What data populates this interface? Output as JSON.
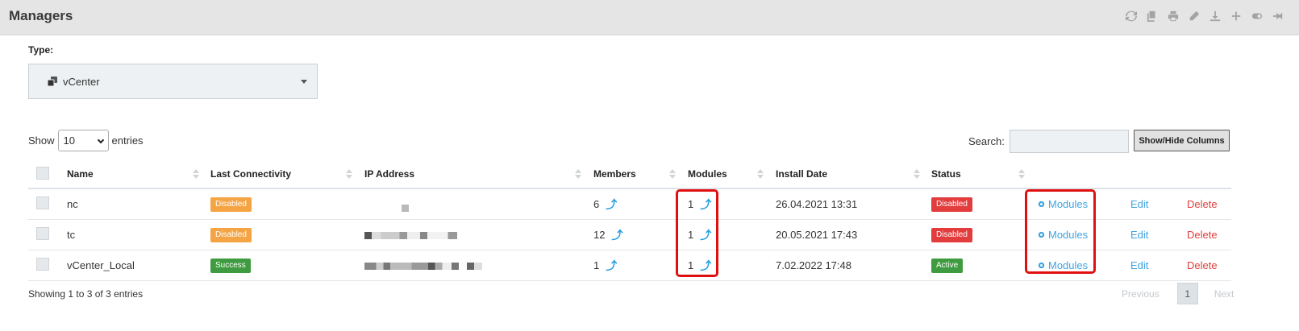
{
  "header": {
    "title": "Managers"
  },
  "toolbar_icons": [
    "refresh-icon",
    "copy-icon",
    "print-icon",
    "edit-icon",
    "download-icon",
    "plus-icon",
    "toggle-icon",
    "pin-icon"
  ],
  "filter": {
    "type_label": "Type:",
    "type_value": "vCenter"
  },
  "length": {
    "show_label": "Show",
    "value": "10",
    "entries_label": "entries"
  },
  "search": {
    "label": "Search:",
    "placeholder": ""
  },
  "columns_button": "Show/Hide Columns",
  "table": {
    "headers": [
      "Name",
      "Last Connectivity",
      "IP Address",
      "Members",
      "Modules",
      "Install Date",
      "Status"
    ],
    "rows": [
      {
        "name": "nc",
        "connectivity": "Disabled",
        "members": "6",
        "modules": "1",
        "install_date": "26.04.2021 13:31",
        "status": "Disabled",
        "action_modules": "Modules",
        "action_edit": "Edit",
        "action_delete": "Delete"
      },
      {
        "name": "tc",
        "connectivity": "Disabled",
        "members": "12",
        "modules": "1",
        "install_date": "20.05.2021 17:43",
        "status": "Disabled",
        "action_modules": "Modules",
        "action_edit": "Edit",
        "action_delete": "Delete"
      },
      {
        "name": "vCenter_Local",
        "connectivity": "Success",
        "members": "1",
        "modules": "1",
        "install_date": "7.02.2022 17:48",
        "status": "Active",
        "action_modules": "Modules",
        "action_edit": "Edit",
        "action_delete": "Delete"
      }
    ]
  },
  "colors": {
    "accent": "#3fa3e0",
    "danger": "#e33c3c",
    "warning": "#f5a443",
    "success": "#3f9b3f",
    "highlight": "#e01010"
  },
  "footer": {
    "info": "Showing 1 to 3 of 3 entries",
    "previous": "Previous",
    "page": "1",
    "next": "Next"
  }
}
